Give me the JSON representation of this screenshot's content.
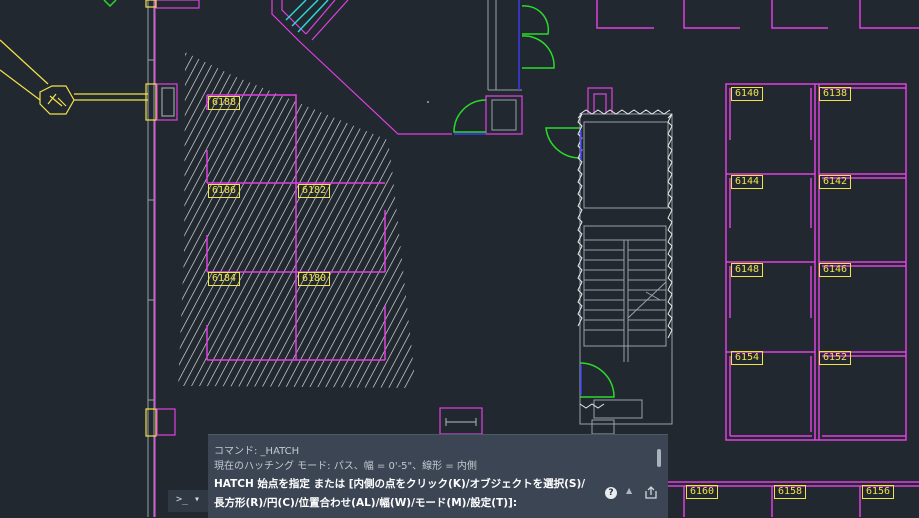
{
  "room_tags": [
    "6188",
    "6186",
    "6182",
    "6184",
    "6180",
    "6140",
    "6138",
    "6144",
    "6142",
    "6148",
    "6146",
    "6154",
    "6152",
    "6160",
    "6158",
    "6156"
  ],
  "command_window": {
    "history_1": "コマンド: _HATCH",
    "history_2": "現在のハッチング モード: パス、幅 = 0'-5\"、線形 = 内側",
    "prompt_1": "HATCH 始点を指定 または [内側の点をクリック(K)/オブジェクトを選択(S)/",
    "prompt_2": "長方形(R)/円(C)/位置合わせ(AL)/幅(W)/モード(M)/設定(T)]:",
    "input_prefix": ">_ ▾",
    "help_glyph": "?",
    "up_glyph": "▲"
  },
  "colors": {
    "background": "#212830",
    "walls": "#e040e0",
    "tags": "#f3e34a",
    "doors": "#2bd92b",
    "blue_lines": "#3a3af0",
    "gray_lines": "#9aa0a6",
    "hatch": "#e8e8e8",
    "cyan": "#2ad6d6"
  },
  "icons": [
    "help-icon",
    "up-arrow-icon",
    "share-icon",
    "command-chevron-icon"
  ]
}
